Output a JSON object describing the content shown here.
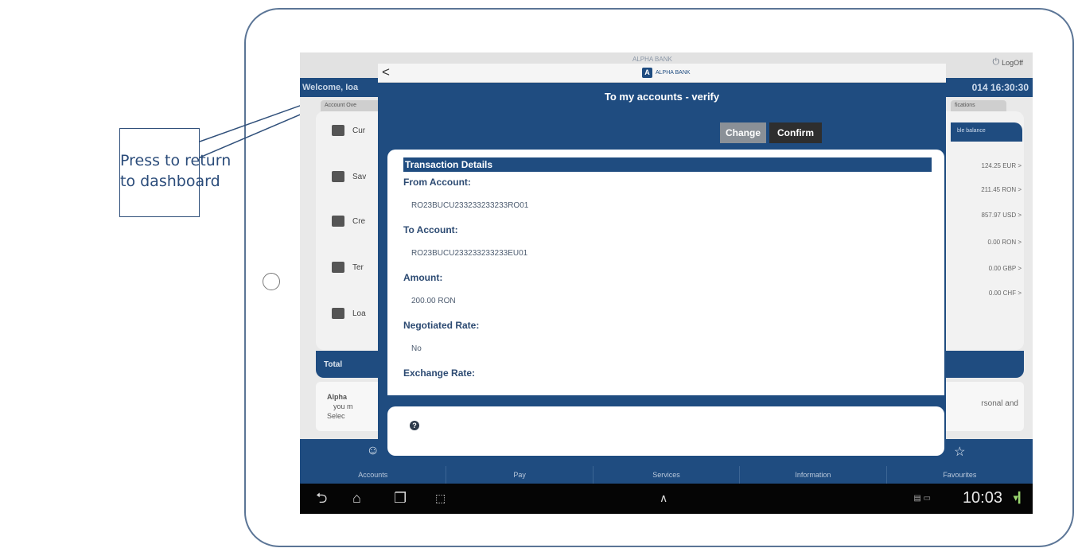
{
  "callout": {
    "line1": "Press to return",
    "line2": "to dashboard"
  },
  "app": {
    "logo_faded": "ALPHA BANK",
    "logoff": "LogOff",
    "welcome": "Welcome, Ioa",
    "datetime": "014 16:30:30",
    "tab_left": "Account Ove",
    "tab_right": "fications",
    "right_header": "ble balance",
    "accounts": [
      {
        "label": "Cur"
      },
      {
        "label": "Sav"
      },
      {
        "label": "Cre"
      },
      {
        "label": "Ter"
      },
      {
        "label": "Loa"
      }
    ],
    "balances": [
      "124.25 EUR >",
      "211.45 RON >",
      "857.97 USD >",
      "0.00 RON >",
      "0.00 GBP >",
      "0.00 CHF >"
    ],
    "total": "Total",
    "info": {
      "line1": "Alpha",
      "line2": "you m",
      "line3": "Selec",
      "right": "rsonal and"
    }
  },
  "bottom_nav": [
    {
      "label": "Accounts",
      "icon": "person-icon",
      "glyph": "☺"
    },
    {
      "label": "Pay",
      "icon": "",
      "glyph": ""
    },
    {
      "label": "Services",
      "icon": "",
      "glyph": ""
    },
    {
      "label": "Information",
      "icon": "",
      "glyph": ""
    },
    {
      "label": "Favourites",
      "icon": "star-icon",
      "glyph": "☆"
    }
  ],
  "android": {
    "clock": "10:03",
    "nav_icons": [
      "back-icon",
      "home-icon",
      "recent-apps-icon",
      "screenshot-icon",
      "chevron-up-icon"
    ]
  },
  "modal": {
    "back": "<",
    "logo": "ALPHA BANK",
    "title": "To my accounts - verify",
    "change_label": "Change",
    "confirm_label": "Confirm",
    "details_header": "Transaction Details",
    "fields": [
      {
        "label": "From Account:",
        "value": "RO23BUCU233233233233RO01"
      },
      {
        "label": "To Account:",
        "value": "RO23BUCU233233233233EU01"
      },
      {
        "label": "Amount:",
        "value": "200.00 RON"
      },
      {
        "label": "Negotiated Rate:",
        "value": "No"
      },
      {
        "label": "Exchange Rate:",
        "value": ""
      }
    ]
  }
}
